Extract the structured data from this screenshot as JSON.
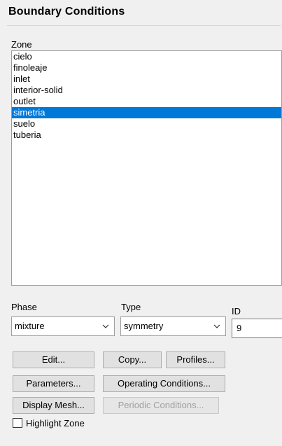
{
  "panel": {
    "title": "Boundary Conditions"
  },
  "zone": {
    "label": "Zone",
    "items": [
      "cielo",
      "finoleaje",
      "inlet",
      "interior-solid",
      "outlet",
      "simetria",
      "suelo",
      "tuberia"
    ],
    "selected": "simetria"
  },
  "phase": {
    "label": "Phase",
    "value": "mixture"
  },
  "type": {
    "label": "Type",
    "value": "symmetry"
  },
  "id": {
    "label": "ID",
    "value": "9"
  },
  "buttons": {
    "edit": "Edit...",
    "copy": "Copy...",
    "profiles": "Profiles...",
    "parameters": "Parameters...",
    "operating_conditions": "Operating Conditions...",
    "display_mesh": "Display Mesh...",
    "periodic_conditions": "Periodic Conditions..."
  },
  "highlight_zone": {
    "label": "Highlight Zone",
    "checked": false
  },
  "icons": {
    "dropdown": "chevron-down-icon",
    "checkbox": "checkbox-icon"
  },
  "colors": {
    "selection": "#0078d7",
    "panel_bg": "#f0f0f0"
  }
}
